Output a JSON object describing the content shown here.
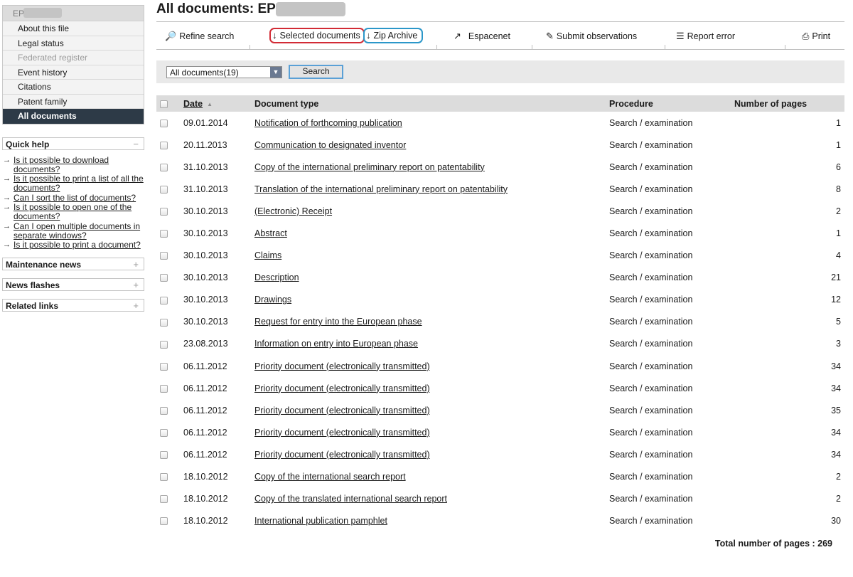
{
  "sidebar": {
    "header": "EP",
    "items": [
      {
        "label": "About this file"
      },
      {
        "label": "Legal status"
      },
      {
        "label": "Federated register"
      },
      {
        "label": "Event history"
      },
      {
        "label": "Citations"
      },
      {
        "label": "Patent family"
      },
      {
        "label": "All documents"
      }
    ],
    "quick_help": {
      "title": "Quick help",
      "toggle": "−",
      "links": [
        "Is it possible to download documents?",
        "Is it possible to print a list of all the documents?",
        "Can I sort the list of documents?",
        "Is it possible to open one of the documents?",
        "Can I open multiple documents in separate windows?",
        "Is it possible to print a document?"
      ]
    },
    "panels": [
      {
        "title": "Maintenance news",
        "toggle": "+"
      },
      {
        "title": "News flashes",
        "toggle": "+"
      },
      {
        "title": "Related links",
        "toggle": "+"
      }
    ]
  },
  "main": {
    "title": "All documents: EP",
    "toolbar": {
      "refine_search": "Refine search",
      "selected_documents": "Selected documents",
      "zip_archive": "Zip Archive",
      "espacenet": "Espacenet",
      "submit_observations": "Submit observations",
      "report_error": "Report error",
      "print": "Print"
    },
    "filter": {
      "selected": "All documents(19)",
      "search_label": "Search"
    },
    "table": {
      "headers": {
        "date": "Date",
        "document_type": "Document type",
        "procedure": "Procedure",
        "pages": "Number of pages"
      },
      "rows": [
        {
          "date": "09.01.2014",
          "type": "Notification of forthcoming publication",
          "procedure": "Search / examination",
          "pages": "1"
        },
        {
          "date": "20.11.2013",
          "type": "Communication to designated inventor",
          "procedure": "Search / examination",
          "pages": "1"
        },
        {
          "date": "31.10.2013",
          "type": "Copy of the international preliminary report on patentability",
          "procedure": "Search / examination",
          "pages": "6"
        },
        {
          "date": "31.10.2013",
          "type": "Translation of the international preliminary report on patentability",
          "procedure": "Search / examination",
          "pages": "8"
        },
        {
          "date": "30.10.2013",
          "type": "(Electronic) Receipt",
          "procedure": "Search / examination",
          "pages": "2"
        },
        {
          "date": "30.10.2013",
          "type": "Abstract",
          "procedure": "Search / examination",
          "pages": "1"
        },
        {
          "date": "30.10.2013",
          "type": "Claims",
          "procedure": "Search / examination",
          "pages": "4"
        },
        {
          "date": "30.10.2013",
          "type": "Description",
          "procedure": "Search / examination",
          "pages": "21"
        },
        {
          "date": "30.10.2013",
          "type": "Drawings",
          "procedure": "Search / examination",
          "pages": "12"
        },
        {
          "date": "30.10.2013",
          "type": "Request for entry into the European phase",
          "procedure": "Search / examination",
          "pages": "5"
        },
        {
          "date": "23.08.2013",
          "type": "Information on entry into European phase",
          "procedure": "Search / examination",
          "pages": "3"
        },
        {
          "date": "06.11.2012",
          "type": "Priority document (electronically transmitted)",
          "procedure": "Search / examination",
          "pages": "34"
        },
        {
          "date": "06.11.2012",
          "type": "Priority document (electronically transmitted)",
          "procedure": "Search / examination",
          "pages": "34"
        },
        {
          "date": "06.11.2012",
          "type": "Priority document (electronically transmitted)",
          "procedure": "Search / examination",
          "pages": "35"
        },
        {
          "date": "06.11.2012",
          "type": "Priority document (electronically transmitted)",
          "procedure": "Search / examination",
          "pages": "34"
        },
        {
          "date": "06.11.2012",
          "type": "Priority document (electronically transmitted)",
          "procedure": "Search / examination",
          "pages": "34"
        },
        {
          "date": "18.10.2012",
          "type": "Copy of the international search report",
          "procedure": "Search / examination",
          "pages": "2"
        },
        {
          "date": "18.10.2012",
          "type": "Copy of the translated international search report",
          "procedure": "Search / examination",
          "pages": "2"
        },
        {
          "date": "18.10.2012",
          "type": "International publication pamphlet",
          "procedure": "Search / examination",
          "pages": "30"
        }
      ]
    },
    "total": "Total number of pages : 269"
  },
  "colors": {
    "active_nav": "#2d3a47",
    "red_highlight": "#d22b35",
    "blue_highlight": "#2b97c9",
    "table_header": "#dcdcdc"
  }
}
